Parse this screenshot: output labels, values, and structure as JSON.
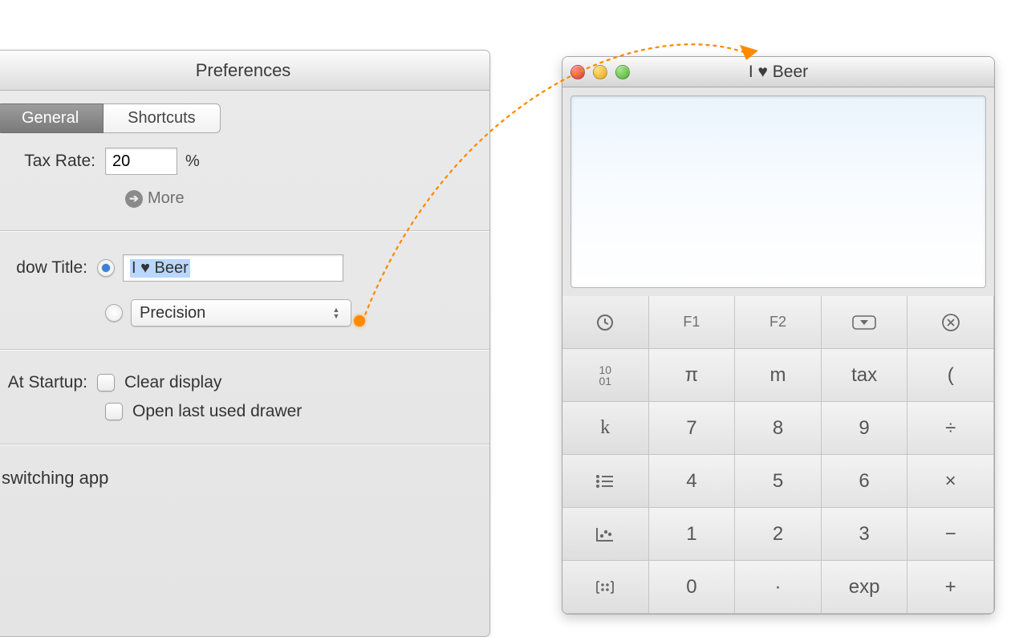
{
  "prefs": {
    "window_title": "Preferences",
    "tabs": {
      "general": "General",
      "shortcuts": "Shortcuts"
    },
    "tax_rate": {
      "label": "Tax Rate:",
      "value": "20",
      "unit": "%"
    },
    "more_label": "More",
    "window_title_row": {
      "label": "dow Title:",
      "custom_value": "I ♥ Beer",
      "precision_option": "Precision"
    },
    "startup": {
      "label": "At Startup:",
      "clear_display": "Clear display",
      "open_last_drawer": "Open last used drawer"
    },
    "switching_app": "switching app"
  },
  "calc": {
    "window_title": "I ♥ Beer",
    "keys": {
      "r1": [
        "",
        "F1",
        "F2",
        "",
        ""
      ],
      "r2": [
        "",
        "π",
        "m",
        "tax",
        "("
      ],
      "r3": [
        "k",
        "7",
        "8",
        "9",
        "÷"
      ],
      "r4": [
        "",
        "4",
        "5",
        "6",
        "×"
      ],
      "r5": [
        "",
        "1",
        "2",
        "3",
        "−"
      ],
      "r6": [
        "",
        "0",
        "·",
        "exp",
        "+"
      ],
      "binary_label": [
        "10",
        "01"
      ]
    }
  }
}
